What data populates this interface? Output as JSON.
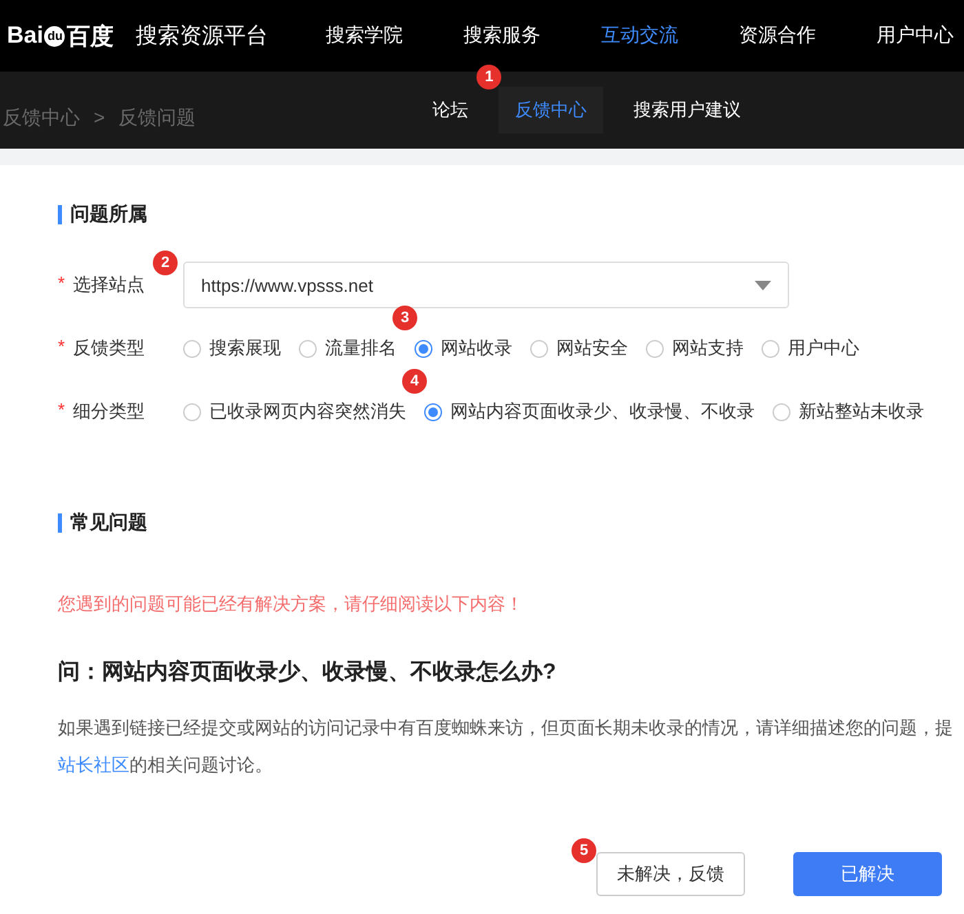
{
  "header": {
    "logo_text": "Bai",
    "logo_paw": "du",
    "logo_cn": "百度",
    "platform": "搜索资源平台",
    "nav": [
      {
        "label": "搜索学院",
        "selected": false
      },
      {
        "label": "搜索服务",
        "selected": false
      },
      {
        "label": "互动交流",
        "selected": true
      },
      {
        "label": "资源合作",
        "selected": false
      },
      {
        "label": "用户中心",
        "selected": false
      }
    ]
  },
  "subbar": {
    "breadcrumb": [
      "反馈中心",
      ">",
      "反馈问题"
    ],
    "tabs": [
      {
        "label": "论坛",
        "selected": false
      },
      {
        "label": "反馈中心",
        "selected": true,
        "badge": "1"
      },
      {
        "label": "搜索用户建议",
        "selected": false
      }
    ]
  },
  "section1": {
    "title": "问题所属",
    "site": {
      "label": "选择站点",
      "required": "*",
      "value": "https://www.vpsss.net",
      "badge": "2"
    },
    "groups": [
      {
        "label": "反馈类型",
        "required": "*",
        "options": [
          {
            "label": "搜索展现",
            "selected": false
          },
          {
            "label": "流量排名",
            "selected": false
          },
          {
            "label": "网站收录",
            "selected": true,
            "badge": "3"
          },
          {
            "label": "网站安全",
            "selected": false
          },
          {
            "label": "网站支持",
            "selected": false
          },
          {
            "label": "用户中心",
            "selected": false
          }
        ]
      },
      {
        "label": "细分类型",
        "required": "*",
        "options": [
          {
            "label": "已收录网页内容突然消失",
            "selected": false
          },
          {
            "label": "网站内容页面收录少、收录慢、不收录",
            "selected": true,
            "badge": "4"
          },
          {
            "label": "新站整站未收录",
            "selected": false
          }
        ]
      }
    ]
  },
  "section2": {
    "title": "常见问题",
    "notice": "您遇到的问题可能已经有解决方案，请仔细阅读以下内容！",
    "question": "问：网站内容页面收录少、收录慢、不收录怎么办?",
    "answer_line1": "如果遇到链接已经提交或网站的访问记录中有百度蜘蛛来访，但页面长期未收录的情况，请详细描述您的问题，提",
    "link": "站长社区",
    "answer_tail": "的相关问题讨论。"
  },
  "buttons": [
    {
      "label": "未解决，反馈",
      "kind": "secondary",
      "badge": "5"
    },
    {
      "label": "已解决",
      "kind": "primary"
    }
  ]
}
